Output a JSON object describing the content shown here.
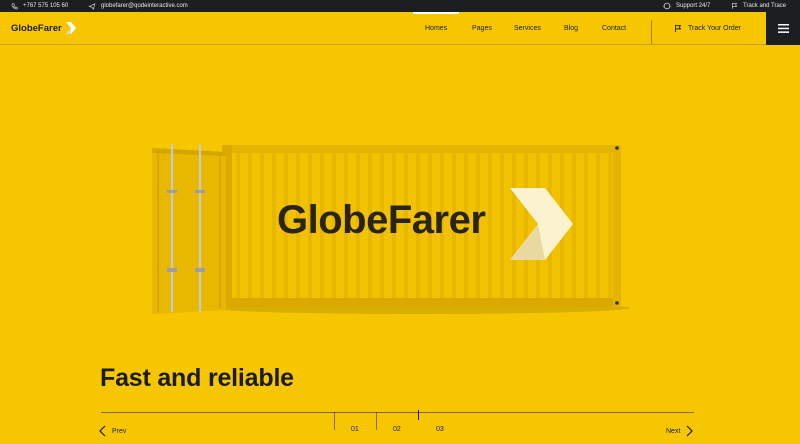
{
  "topbar": {
    "phone": "+767 575 105 60",
    "email": "globefarer@qodeinteractive.com",
    "support": "Support 24/7",
    "track_trace": "Track and Trace"
  },
  "nav": {
    "logo_text": "GlobeFarer",
    "items": [
      {
        "label": "Homes",
        "active": true
      },
      {
        "label": "Pages",
        "active": false
      },
      {
        "label": "Services",
        "active": false
      },
      {
        "label": "Blog",
        "active": false
      },
      {
        "label": "Contact",
        "active": false
      }
    ],
    "track_order": "Track Your Order"
  },
  "hero": {
    "container_brand": "GlobeFarer",
    "headline": "Fast and reliable",
    "prev": "Prev",
    "next": "Next",
    "slides": [
      "01",
      "02",
      "03"
    ],
    "active_slide": 2
  },
  "colors": {
    "brand_yellow": "#f6c700",
    "dark": "#1d1e22",
    "text": "#1b1b1b"
  },
  "icons": [
    "phone-icon",
    "mail-icon",
    "support-icon",
    "flag-icon",
    "logo-chevron-icon",
    "menu-icon",
    "chevron-left-icon",
    "chevron-right-icon"
  ]
}
